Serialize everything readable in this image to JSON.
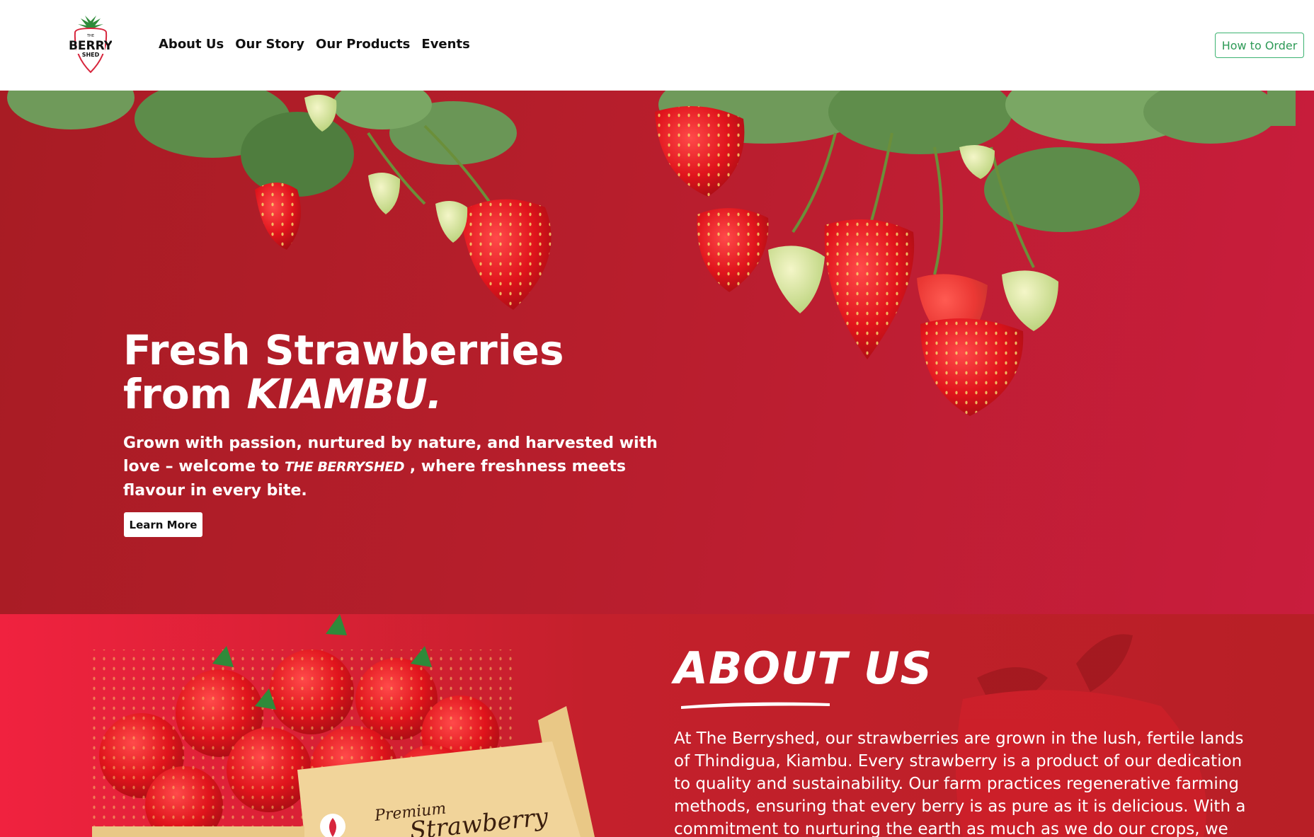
{
  "header": {
    "logo": {
      "alt": "The Berry Shed",
      "icon": "strawberry-logo-icon"
    },
    "nav": [
      {
        "label": "About Us"
      },
      {
        "label": "Our Story"
      },
      {
        "label": "Our Products"
      },
      {
        "label": "Events"
      }
    ],
    "order_button": "How to Order"
  },
  "hero": {
    "title_line1": "Fresh Strawberries",
    "title_line2_prefix": "from",
    "title_line2_script": "Kiambu.",
    "subtitle_before": "Grown with passion, nurtured by nature, and harvested with love – welcome to",
    "subtitle_brand": "The Berryshed",
    "subtitle_after": ", where freshness meets flavour in every bite.",
    "button": "Learn More",
    "image": "strawberry-plants-image"
  },
  "about": {
    "title": "About Us",
    "text": "At The Berryshed, our strawberries are grown in the lush, fertile lands of Thindigua, Kiambu. Every strawberry is a product of our dedication to quality and sustainability. Our farm practices regenerative farming methods, ensuring that every berry is as pure as it is delicious. With a commitment to nurturing the earth as much as we do our crops, we take",
    "crate_label": "Premium Strawberry",
    "image": "strawberry-crate-image"
  },
  "colors": {
    "hero_red": "#b71e2c",
    "about_red": "#c4202c",
    "accent_green": "#3cb371",
    "white": "#ffffff"
  }
}
